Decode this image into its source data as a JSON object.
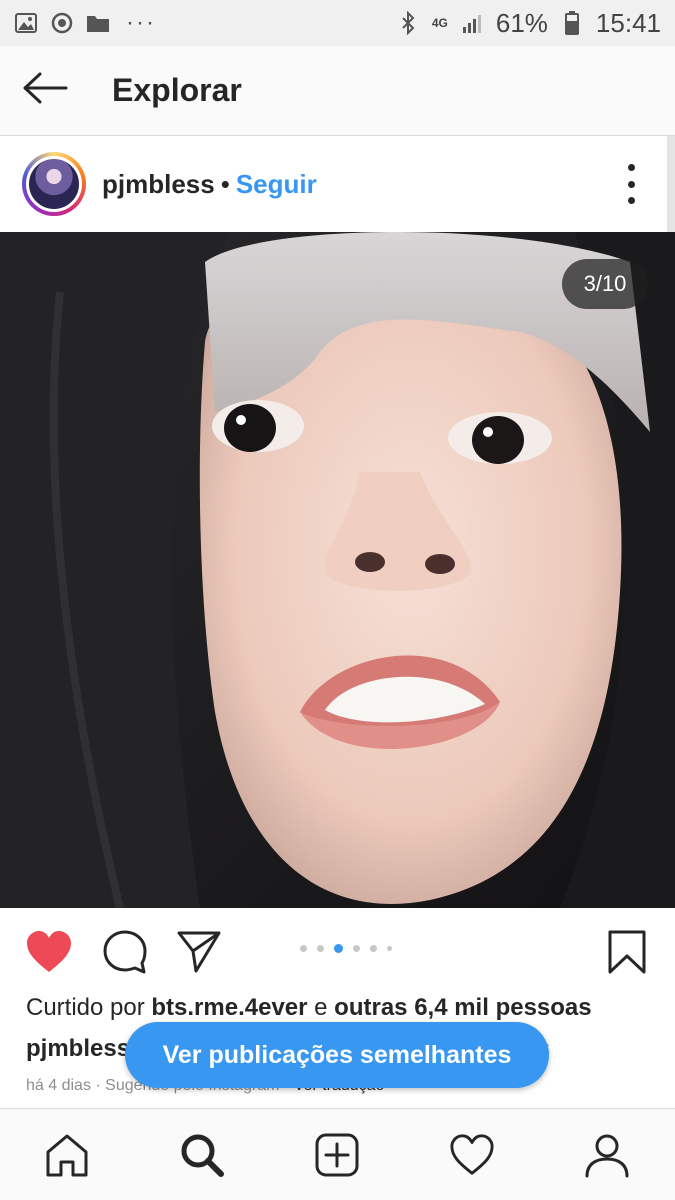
{
  "status_bar": {
    "battery": "61%",
    "time": "15:41",
    "network": "4G",
    "dots": "···",
    "icons": [
      "image-icon",
      "sync-icon",
      "folder-icon",
      "bluetooth-icon",
      "signal-icon",
      "battery-icon"
    ]
  },
  "header": {
    "title": "Explorar"
  },
  "post": {
    "username": "pjmbless",
    "separator": "•",
    "follow_label": "Seguir",
    "counter": "3/10",
    "carousel": {
      "current": 3,
      "visible_dots": 6
    },
    "liked": true,
    "likes_prefix": "Curtido por ",
    "likes_user": "bts.rme.4ever",
    "likes_conj": " e ",
    "likes_others": "outras 6,4 mil pessoas",
    "caption_user": "pjmbless",
    "caption_faded": "s",
    "meta_time": "há 4 dias",
    "meta_sep": " · ",
    "meta_suggested": "Sugerido pelo Instagram",
    "meta_translate": "Ver tradução"
  },
  "similar_button_label": "Ver publicações semelhantes",
  "bottom_nav": [
    "home-icon",
    "search-icon",
    "add-icon",
    "heart-icon",
    "profile-icon"
  ],
  "colors": {
    "accent": "#3897f0",
    "like": "#ed4956",
    "text": "#262626"
  }
}
